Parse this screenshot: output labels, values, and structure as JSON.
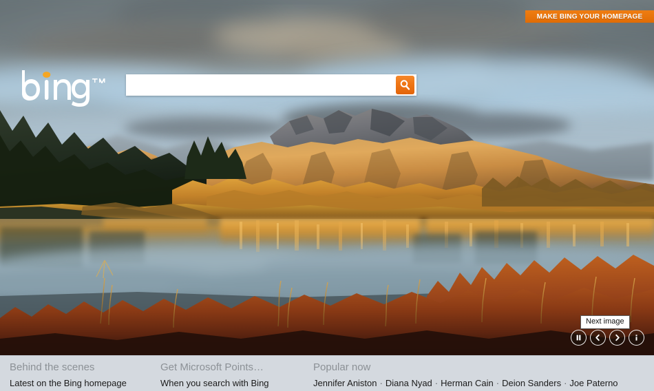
{
  "banner": {
    "label": "MAKE BING YOUR HOMEPAGE",
    "color": "#e8710a"
  },
  "logo": {
    "wordmark": "bing",
    "trademark": "TM",
    "dot_color": "#f5a623"
  },
  "search": {
    "value": "",
    "placeholder": "",
    "button_icon": "search-icon",
    "button_color": "#ef7615"
  },
  "media_controls": {
    "tooltip": "Next image",
    "buttons": [
      {
        "name": "pause-button",
        "icon": "pause-icon",
        "label": "Pause"
      },
      {
        "name": "previous-image-button",
        "icon": "chevron-left-icon",
        "label": "Previous image"
      },
      {
        "name": "next-image-button",
        "icon": "chevron-right-icon",
        "label": "Next image"
      },
      {
        "name": "image-info-button",
        "icon": "info-icon",
        "label": "Image information"
      }
    ]
  },
  "bottom_bar": {
    "background": "#d4d9df",
    "columns": [
      {
        "heading": "Behind the scenes",
        "sub": "Latest on the Bing homepage"
      },
      {
        "heading": "Get Microsoft Points…",
        "sub": "When you search with Bing"
      },
      {
        "heading": "Popular now",
        "trends": [
          "Jennifer Aniston",
          "Diana Nyad",
          "Herman Cain",
          "Deion Sanders",
          "Joe Paterno"
        ],
        "separator": "·"
      }
    ]
  },
  "background_image": {
    "description": "Autumn sunrise over a river bend with golden-lit mountain peaks, storm clouds, evergreen and aspen trees, and red-brown foreground shrubs"
  }
}
